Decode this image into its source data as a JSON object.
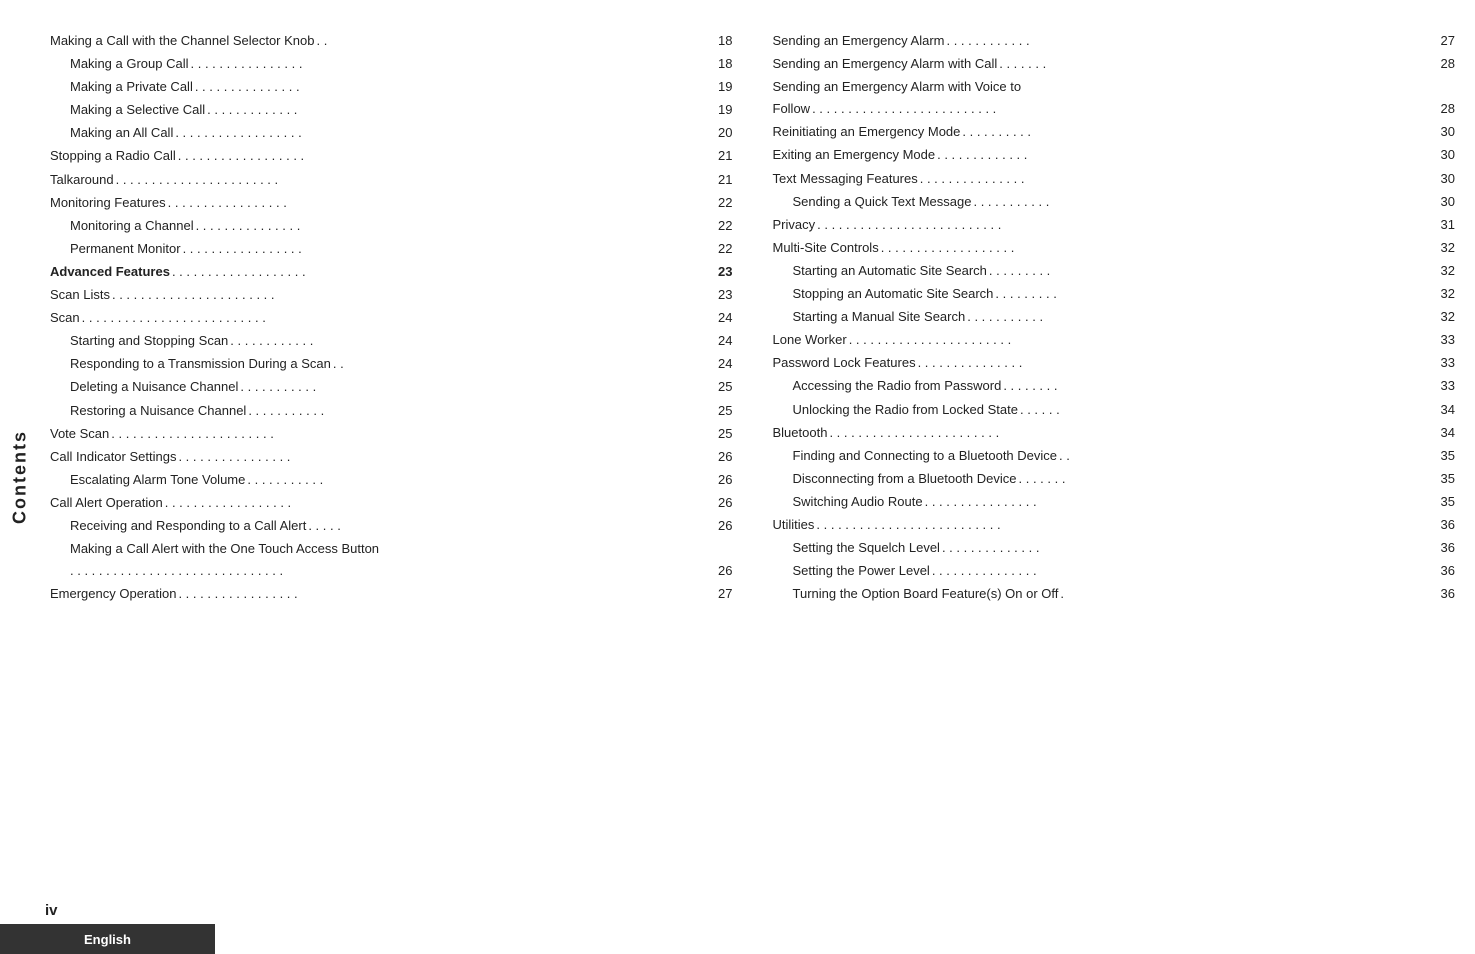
{
  "sidebar": {
    "label": "Contents"
  },
  "bottom_bar": {
    "language": "English"
  },
  "page_number": "iv",
  "left_column": [
    {
      "text": "Making a Call with the Channel Selector Knob",
      "dots": " . .",
      "page": "18",
      "indent": 0,
      "bold": false
    },
    {
      "text": "Making a Group Call",
      "dots": " . . . . . . . . . . . . . . . .",
      "page": "18",
      "indent": 1,
      "bold": false
    },
    {
      "text": "Making a Private Call",
      "dots": " . . . . . . . . . . . . . . .",
      "page": "19",
      "indent": 1,
      "bold": false
    },
    {
      "text": "Making a Selective Call",
      "dots": " . . . . . . . . . . . . .",
      "page": "19",
      "indent": 1,
      "bold": false
    },
    {
      "text": "Making an All Call",
      "dots": " . . . . . . . . . . . . . . . . . .",
      "page": "20",
      "indent": 1,
      "bold": false
    },
    {
      "text": "Stopping a Radio Call",
      "dots": " . . . . . . . . . . . . . . . . . .",
      "page": "21",
      "indent": 0,
      "bold": false
    },
    {
      "text": "Talkaround",
      "dots": " . . . . . . . . . . . . . . . . . . . . . . .",
      "page": "21",
      "indent": 0,
      "bold": false
    },
    {
      "text": "Monitoring Features",
      "dots": " . . . . . . . . . . . . . . . . .",
      "page": "22",
      "indent": 0,
      "bold": false
    },
    {
      "text": "Monitoring a Channel",
      "dots": " . . . . . . . . . . . . . . .",
      "page": "22",
      "indent": 1,
      "bold": false
    },
    {
      "text": "Permanent Monitor",
      "dots": " . . . . . . . . . . . . . . . . .",
      "page": "22",
      "indent": 1,
      "bold": false
    },
    {
      "text": "Advanced Features",
      "dots": " . . . . . . . . . . . . . . . . . . .",
      "page": "23",
      "indent": 0,
      "bold": true
    },
    {
      "text": "Scan Lists",
      "dots": " . . . . . . . . . . . . . . . . . . . . . . .",
      "page": "23",
      "indent": 0,
      "bold": false
    },
    {
      "text": "Scan",
      "dots": " . . . . . . . . . . . . . . . . . . . . . . . . . .",
      "page": "24",
      "indent": 0,
      "bold": false
    },
    {
      "text": "Starting and Stopping Scan",
      "dots": " . . . . . . . . . . . .",
      "page": "24",
      "indent": 1,
      "bold": false
    },
    {
      "text": "Responding to a Transmission During a Scan",
      "dots": " . .",
      "page": "24",
      "indent": 1,
      "bold": false
    },
    {
      "text": "Deleting a Nuisance Channel",
      "dots": " . . . . . . . . . . .",
      "page": "25",
      "indent": 1,
      "bold": false
    },
    {
      "text": "Restoring a Nuisance Channel",
      "dots": " . . . . . . . . . . .",
      "page": "25",
      "indent": 1,
      "bold": false
    },
    {
      "text": "Vote Scan",
      "dots": " . . . . . . . . . . . . . . . . . . . . . . .",
      "page": "25",
      "indent": 0,
      "bold": false
    },
    {
      "text": "Call Indicator Settings",
      "dots": " . . . . . . . . . . . . . . . .",
      "page": "26",
      "indent": 0,
      "bold": false
    },
    {
      "text": "Escalating Alarm Tone Volume",
      "dots": " . . . . . . . . . . .",
      "page": "26",
      "indent": 1,
      "bold": false
    },
    {
      "text": "Call Alert Operation",
      "dots": " . . . . . . . . . . . . . . . . . .",
      "page": "26",
      "indent": 0,
      "bold": false
    },
    {
      "text": "Receiving and Responding to a Call Alert",
      "dots": " . . . . .",
      "page": "26",
      "indent": 1,
      "bold": false
    },
    {
      "text": "Making a Call Alert with the One Touch Access Button",
      "dots": "",
      "page": "",
      "indent": 1,
      "bold": false,
      "wrapped": true,
      "wrapped_dots": " . . . . . . . . . . . . . . . . . . . . . . . . . . . . . .",
      "wrapped_page": "26"
    },
    {
      "text": "Emergency Operation",
      "dots": " . . . . . . . . . . . . . . . . .",
      "page": "27",
      "indent": 0,
      "bold": false
    }
  ],
  "right_column": [
    {
      "text": "Sending an Emergency Alarm",
      "dots": " . . . . . . . . . . . .",
      "page": "27",
      "indent": 0,
      "bold": false
    },
    {
      "text": "Sending an Emergency Alarm with Call",
      "dots": " . . . . . . .",
      "page": "28",
      "indent": 0,
      "bold": false
    },
    {
      "text": "Sending an Emergency Alarm with Voice to Follow",
      "dots": " . . . . . . . . . . . . . . . . . . . . . . . . . .",
      "page": "28",
      "indent": 0,
      "bold": false,
      "multiline": true
    },
    {
      "text": "Reinitiating an Emergency Mode",
      "dots": " . . . . . . . . . .",
      "page": "30",
      "indent": 0,
      "bold": false
    },
    {
      "text": "Exiting an Emergency Mode",
      "dots": " . . . . . . . . . . . . .",
      "page": "30",
      "indent": 0,
      "bold": false
    },
    {
      "text": "Text Messaging Features",
      "dots": " . . . . . . . . . . . . . . .",
      "page": "30",
      "indent": 0,
      "bold": false
    },
    {
      "text": "Sending a Quick Text Message",
      "dots": " . . . . . . . . . . .",
      "page": "30",
      "indent": 1,
      "bold": false
    },
    {
      "text": "Privacy",
      "dots": " . . . . . . . . . . . . . . . . . . . . . . . . . .",
      "page": "31",
      "indent": 0,
      "bold": false
    },
    {
      "text": "Multi-Site Controls",
      "dots": " . . . . . . . . . . . . . . . . . . .",
      "page": "32",
      "indent": 0,
      "bold": false
    },
    {
      "text": "Starting an Automatic Site Search",
      "dots": " . . . . . . . . .",
      "page": "32",
      "indent": 1,
      "bold": false
    },
    {
      "text": "Stopping an Automatic Site Search",
      "dots": " . . . . . . . . .",
      "page": "32",
      "indent": 1,
      "bold": false
    },
    {
      "text": "Starting a Manual Site Search",
      "dots": " . . . . . . . . . . .",
      "page": "32",
      "indent": 1,
      "bold": false
    },
    {
      "text": "Lone Worker",
      "dots": " . . . . . . . . . . . . . . . . . . . . . . .",
      "page": "33",
      "indent": 0,
      "bold": false
    },
    {
      "text": "Password Lock Features",
      "dots": " . . . . . . . . . . . . . . .",
      "page": "33",
      "indent": 0,
      "bold": false
    },
    {
      "text": "Accessing the Radio from Password",
      "dots": " . . . . . . . .",
      "page": "33",
      "indent": 1,
      "bold": false
    },
    {
      "text": "Unlocking the Radio from Locked State",
      "dots": " . . . . . .",
      "page": "34",
      "indent": 1,
      "bold": false
    },
    {
      "text": "Bluetooth",
      "dots": " . . . . . . . . . . . . . . . . . . . . . . . .",
      "page": "34",
      "indent": 0,
      "bold": false
    },
    {
      "text": "Finding and Connecting to a Bluetooth Device",
      "dots": " . .",
      "page": "35",
      "indent": 1,
      "bold": false
    },
    {
      "text": "Disconnecting from a Bluetooth Device",
      "dots": " . . . . . . .",
      "page": "35",
      "indent": 1,
      "bold": false
    },
    {
      "text": "Switching Audio Route",
      "dots": " . . . . . . . . . . . . . . . .",
      "page": "35",
      "indent": 1,
      "bold": false
    },
    {
      "text": "Utilities",
      "dots": " . . . . . . . . . . . . . . . . . . . . . . . . . .",
      "page": "36",
      "indent": 0,
      "bold": false
    },
    {
      "text": "Setting the Squelch Level",
      "dots": " . . . . . . . . . . . . . .",
      "page": "36",
      "indent": 1,
      "bold": false
    },
    {
      "text": "Setting the Power Level",
      "dots": " . . . . . . . . . . . . . . .",
      "page": "36",
      "indent": 1,
      "bold": false
    },
    {
      "text": "Turning the Option Board Feature(s) On or Off",
      "dots": " .",
      "page": "36",
      "indent": 1,
      "bold": false
    }
  ]
}
